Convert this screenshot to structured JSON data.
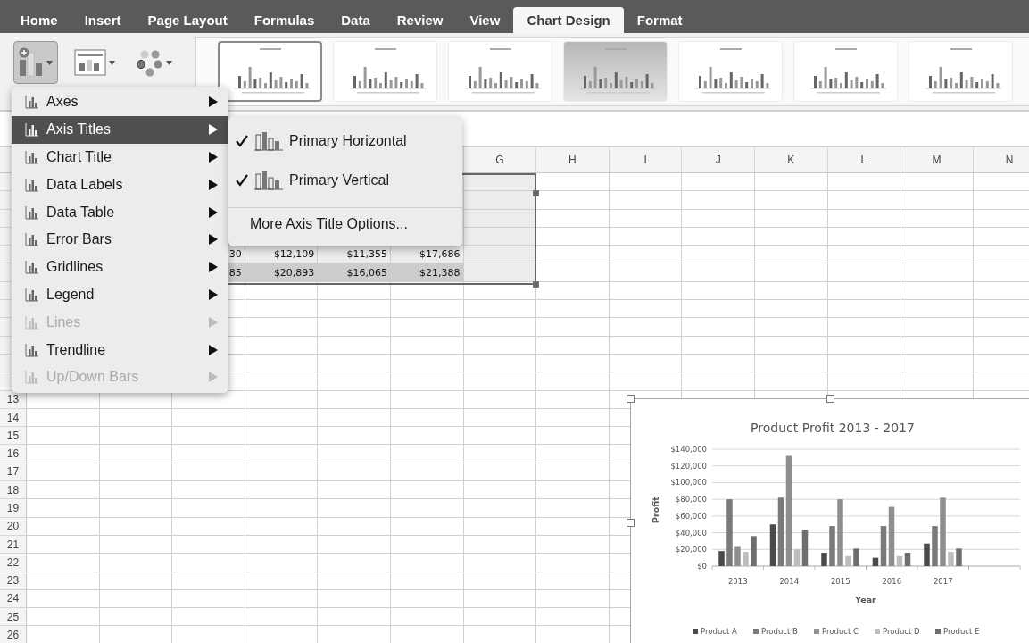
{
  "tabs": [
    {
      "label": "Home",
      "selected": false
    },
    {
      "label": "Insert",
      "selected": false
    },
    {
      "label": "Page Layout",
      "selected": false
    },
    {
      "label": "Formulas",
      "selected": false
    },
    {
      "label": "Data",
      "selected": false
    },
    {
      "label": "Review",
      "selected": false
    },
    {
      "label": "View",
      "selected": false
    },
    {
      "label": "Chart Design",
      "selected": true
    },
    {
      "label": "Format",
      "selected": false
    }
  ],
  "ribbon": {
    "buttons": [
      {
        "kind": "add-element",
        "pressed": true
      },
      {
        "kind": "quick-layout",
        "pressed": false
      },
      {
        "kind": "colors",
        "pressed": false
      }
    ],
    "chart_styles": [
      {
        "selected": true,
        "shaded": false
      },
      {
        "selected": false,
        "shaded": false
      },
      {
        "selected": false,
        "shaded": false
      },
      {
        "selected": false,
        "shaded": true
      },
      {
        "selected": false,
        "shaded": false
      },
      {
        "selected": false,
        "shaded": false
      },
      {
        "selected": false,
        "shaded": false
      }
    ]
  },
  "sheet": {
    "column_headers": [
      "G",
      "H",
      "I",
      "J",
      "K",
      "L",
      "M",
      "N"
    ],
    "row_numbers": [
      "13",
      "14",
      "15",
      "16",
      "17",
      "18",
      "19",
      "20",
      "21",
      "22",
      "23",
      "24",
      "25",
      "26"
    ],
    "table_rows": [
      {
        "cells": [
          "30",
          "$12,109",
          "$11,355",
          "$17,686"
        ],
        "highlighted": false
      },
      {
        "cells": [
          "85",
          "$20,893",
          "$16,065",
          "$21,388"
        ],
        "highlighted": true
      }
    ]
  },
  "menu": {
    "items": [
      {
        "label": "Axes",
        "selected": false,
        "disabled": false
      },
      {
        "label": "Axis Titles",
        "selected": true,
        "disabled": false
      },
      {
        "label": "Chart Title",
        "selected": false,
        "disabled": false
      },
      {
        "label": "Data Labels",
        "selected": false,
        "disabled": false
      },
      {
        "label": "Data Table",
        "selected": false,
        "disabled": false
      },
      {
        "label": "Error Bars",
        "selected": false,
        "disabled": false
      },
      {
        "label": "Gridlines",
        "selected": false,
        "disabled": false
      },
      {
        "label": "Legend",
        "selected": false,
        "disabled": false
      },
      {
        "label": "Lines",
        "selected": false,
        "disabled": true
      },
      {
        "label": "Trendline",
        "selected": false,
        "disabled": false
      },
      {
        "label": "Up/Down Bars",
        "selected": false,
        "disabled": true
      }
    ]
  },
  "submenu": {
    "items": [
      {
        "kind": "option",
        "label": "Primary Horizontal",
        "checked": true
      },
      {
        "kind": "option",
        "label": "Primary Vertical",
        "checked": true
      },
      {
        "kind": "action",
        "label": "More Axis Title Options..."
      }
    ]
  },
  "chart": {
    "chart_data": {
      "type": "bar",
      "title": "Product Profit 2013 - 2017",
      "xlabel": "Year",
      "ylabel": "Profit",
      "categories": [
        "2013",
        "2014",
        "2015",
        "2016",
        "2017"
      ],
      "series": [
        {
          "name": "Product A",
          "color": "#4a4a4a",
          "values": [
            18000,
            50000,
            16000,
            10000,
            27000
          ]
        },
        {
          "name": "Product B",
          "color": "#7a7a7a",
          "values": [
            80000,
            82000,
            48000,
            48000,
            48000
          ]
        },
        {
          "name": "Product C",
          "color": "#8e8e8e",
          "values": [
            24000,
            132000,
            80000,
            71000,
            82000
          ]
        },
        {
          "name": "Product D",
          "color": "#bdbdbd",
          "values": [
            17000,
            20000,
            12000,
            12000,
            17000
          ]
        },
        {
          "name": "Product E",
          "color": "#6e6e6e",
          "values": [
            36000,
            43000,
            21000,
            16000,
            21000
          ]
        }
      ],
      "grid": true,
      "legend": true,
      "ylim": [
        0,
        140000
      ],
      "yticks": [
        {
          "value": 0,
          "label": "$0"
        },
        {
          "value": 20000,
          "label": "$20,000"
        },
        {
          "value": 40000,
          "label": "$40,000"
        },
        {
          "value": 60000,
          "label": "$60,000"
        },
        {
          "value": 80000,
          "label": "$80,000"
        },
        {
          "value": 100000,
          "label": "$100,000"
        },
        {
          "value": 120000,
          "label": "$120,000"
        },
        {
          "value": 140000,
          "label": "$140,000"
        }
      ]
    }
  }
}
